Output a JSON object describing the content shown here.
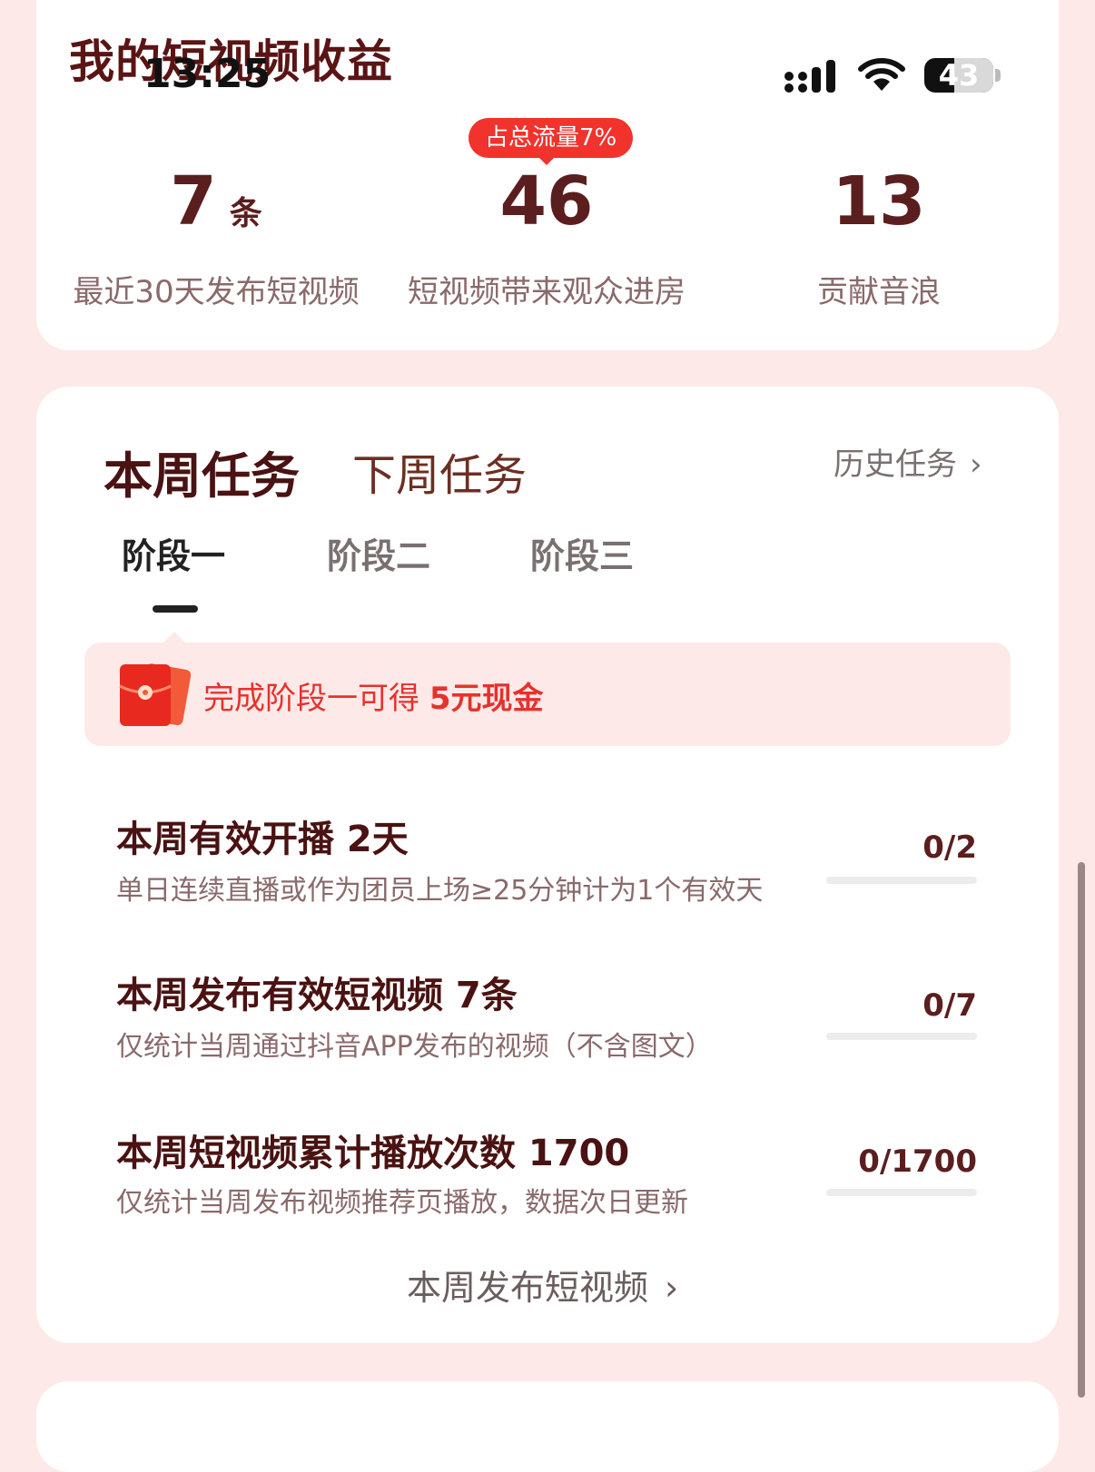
{
  "status_bar": {
    "time": "13:25",
    "battery": "43",
    "battery_level": 0.43
  },
  "header": {
    "title": "我的短视频收益"
  },
  "stats": [
    {
      "value": "7",
      "unit": "条",
      "label": "最近30天发布短视频"
    },
    {
      "value": "46",
      "badge": "占总流量7%",
      "label": "短视频带来观众进房"
    },
    {
      "value": "13",
      "label": "贡献音浪"
    }
  ],
  "tasks": {
    "tab_this_week": "本周任务",
    "tab_next_week": "下周任务",
    "history_link": "历史任务",
    "arrow": "›",
    "stages": [
      "阶段一",
      "阶段二",
      "阶段三"
    ],
    "reward_text": "完成阶段一可得 ",
    "reward_amount": "5元现金",
    "items": [
      {
        "title": "本周有效开播 2天",
        "desc": "单日连续直播或作为团员上场≥25分钟计为1个有效天",
        "progress": "0/2",
        "fraction": 0
      },
      {
        "title": "本周发布有效短视频 7条",
        "desc": "仅统计当周通过抖音APP发布的视频（不含图文）",
        "progress": "0/7",
        "fraction": 0
      },
      {
        "title": "本周短视频累计播放次数 1700",
        "desc": "仅统计当周发布视频推荐页播放，数据次日更新",
        "progress": "0/1700",
        "fraction": 0
      }
    ],
    "publish_link": "本周发布短视频"
  },
  "colors": {
    "accent": "#f2322c",
    "brand_dark": "#4a1212",
    "background": "#fde9e8"
  }
}
